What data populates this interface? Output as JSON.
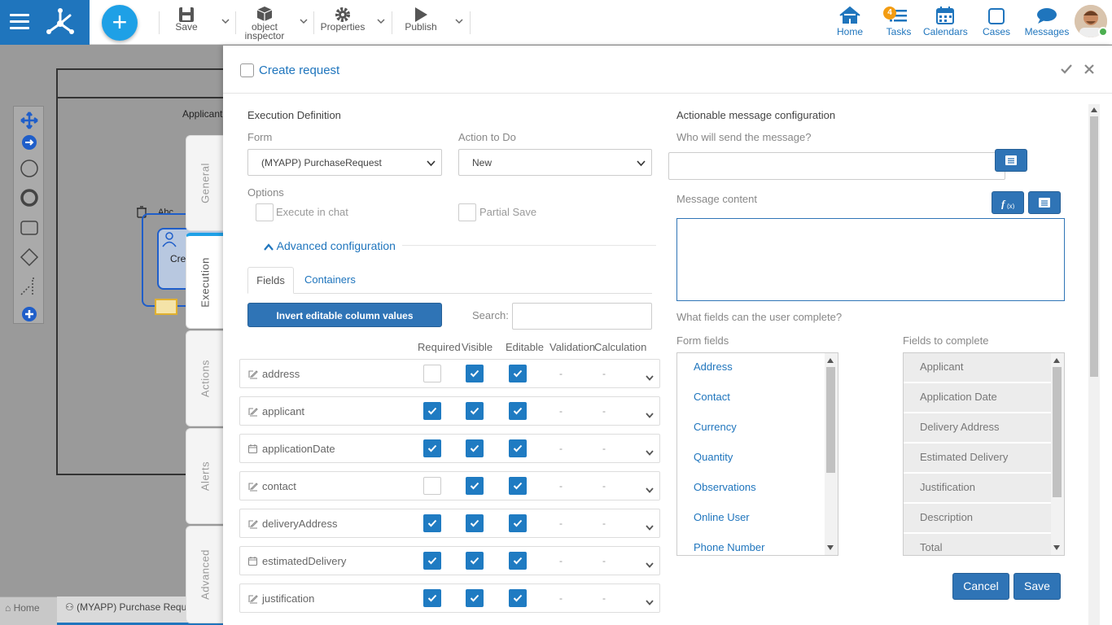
{
  "toolbar": {
    "save": "Save",
    "object_inspector": "object inspector",
    "properties": "Properties",
    "publish": "Publish"
  },
  "nav": {
    "home": "Home",
    "tasks": "Tasks",
    "tasks_badge": "4",
    "calendars": "Calendars",
    "cases": "Cases",
    "messages": "Messages"
  },
  "canvas": {
    "lane_label": "Applicant",
    "shape_text": "Abc",
    "task_label": "Cre"
  },
  "bottom_tabs": {
    "home": "Home",
    "document": "(MYAPP) Purchase Request"
  },
  "side_tabs": [
    "General",
    "Execution",
    "Actions",
    "Alerts",
    "Advanced"
  ],
  "modal": {
    "title": "Create request",
    "execution": {
      "section_title": "Execution Definition",
      "form_label": "Form",
      "form_value": "(MYAPP) PurchaseRequest",
      "action_label": "Action to Do",
      "action_value": "New",
      "options_label": "Options",
      "execute_in_chat": "Execute in chat",
      "partial_save": "Partial Save",
      "advanced_configuration": "Advanced configuration",
      "tabs": [
        "Fields",
        "Containers"
      ],
      "invert_button": "Invert editable column values",
      "search_label": "Search:",
      "columns": [
        "Required",
        "Visible",
        "Editable",
        "Validation",
        "Calculation"
      ],
      "fields": [
        {
          "icon": "edit",
          "name": "address",
          "required": false,
          "visible": true,
          "editable": true,
          "validation": "-",
          "calculation": "-"
        },
        {
          "icon": "edit",
          "name": "applicant",
          "required": true,
          "visible": true,
          "editable": true,
          "validation": "-",
          "calculation": "-"
        },
        {
          "icon": "calendar",
          "name": "applicationDate",
          "required": true,
          "visible": true,
          "editable": true,
          "validation": "-",
          "calculation": "-"
        },
        {
          "icon": "edit",
          "name": "contact",
          "required": false,
          "visible": true,
          "editable": true,
          "validation": "-",
          "calculation": "-"
        },
        {
          "icon": "edit",
          "name": "deliveryAddress",
          "required": true,
          "visible": true,
          "editable": true,
          "validation": "-",
          "calculation": "-"
        },
        {
          "icon": "calendar",
          "name": "estimatedDelivery",
          "required": true,
          "visible": true,
          "editable": true,
          "validation": "-",
          "calculation": "-"
        },
        {
          "icon": "edit",
          "name": "justification",
          "required": true,
          "visible": true,
          "editable": true,
          "validation": "-",
          "calculation": "-"
        }
      ]
    },
    "actionable": {
      "section_title": "Actionable message configuration",
      "who_label": "Who will send the message?",
      "content_label": "Message content",
      "fields_question": "What fields can the user complete?",
      "form_fields_label": "Form fields",
      "fields_to_complete_label": "Fields to complete",
      "form_fields": [
        "Address",
        "Contact",
        "Currency",
        "Quantity",
        "Observations",
        "Online User",
        "Phone Number"
      ],
      "fields_to_complete": [
        "Applicant",
        "Application Date",
        "Delivery Address",
        "Estimated Delivery",
        "Justification",
        "Description",
        "Total"
      ]
    },
    "cancel": "Cancel",
    "save": "Save"
  },
  "colors": {
    "brand": "#1f75bd",
    "accent": "#1ea0e6",
    "button": "#2f74b6"
  }
}
